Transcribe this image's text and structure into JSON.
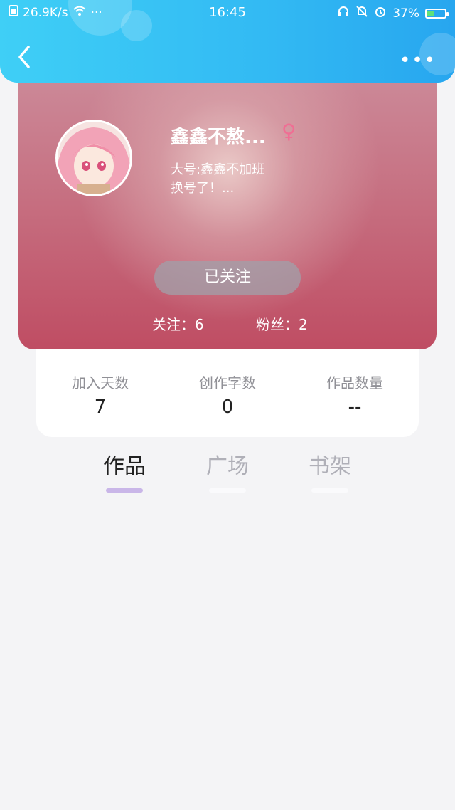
{
  "status_bar": {
    "speed": "26.9K/s",
    "dots": "···",
    "time": "16:45",
    "battery_percent": "37%",
    "battery_level": 0.37,
    "icons": [
      "sim-icon",
      "wifi-icon",
      "headset-icon",
      "bell-off-icon",
      "alarm-icon",
      "battery-icon"
    ]
  },
  "header": {
    "back_icon": "chevron-left-icon",
    "more_label": "•••"
  },
  "profile": {
    "name": "鑫鑫不熬...",
    "gender_symbol": "♀",
    "bio_line1": "大号:鑫鑫不加班",
    "bio_line2": "换号了！...",
    "follow_button_label": "已关注",
    "following": "关注：6",
    "fans": "粉丝：2"
  },
  "info": [
    {
      "label": "加入天数",
      "value": "7"
    },
    {
      "label": "创作字数",
      "value": "0"
    },
    {
      "label": "作品数量",
      "value": "--"
    }
  ],
  "tabs": [
    {
      "label": "作品",
      "active": true
    },
    {
      "label": "广场",
      "active": false
    },
    {
      "label": "书架",
      "active": false
    }
  ],
  "colors": {
    "header_start": "#3fcff6",
    "header_end": "#27a6ef",
    "tab_indicator": "#c9b6e8",
    "gender": "#f06e94"
  }
}
